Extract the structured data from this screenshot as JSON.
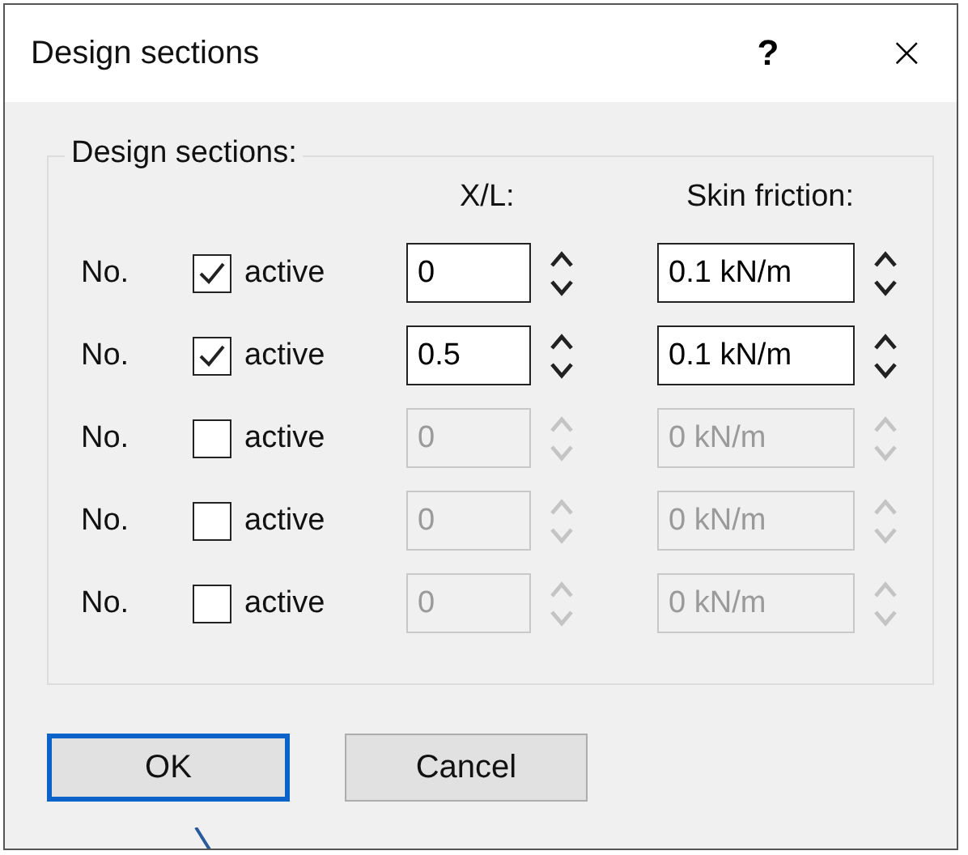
{
  "window": {
    "title": "Design sections",
    "help": "?",
    "close": "×"
  },
  "group": {
    "label": "Design sections:",
    "columns": [
      "X/L:",
      "Skin friction:"
    ],
    "rows": [
      {
        "label": "No.",
        "checkbox": "active",
        "checked": true,
        "disabled": false,
        "x_l": "0",
        "skin_friction": "0.1 kN/m"
      },
      {
        "label": "No.",
        "checkbox": "active",
        "checked": true,
        "disabled": false,
        "x_l": "0.5",
        "skin_friction": "0.1 kN/m"
      },
      {
        "label": "No.",
        "checkbox": "active",
        "checked": false,
        "disabled": true,
        "x_l": "0",
        "skin_friction": "0 kN/m"
      },
      {
        "label": "No.",
        "checkbox": "active",
        "checked": false,
        "disabled": true,
        "x_l": "0",
        "skin_friction": "0 kN/m"
      },
      {
        "label": "No.",
        "checkbox": "active",
        "checked": false,
        "disabled": true,
        "x_l": "0",
        "skin_friction": "0 kN/m"
      }
    ]
  },
  "buttons": [
    {
      "label": "OK",
      "focused": true
    },
    {
      "label": "Cancel",
      "focused": false
    }
  ]
}
